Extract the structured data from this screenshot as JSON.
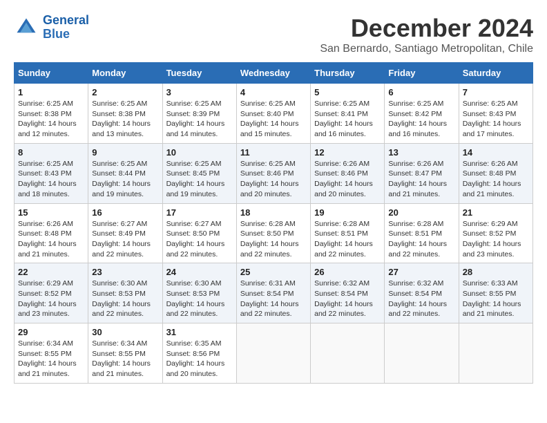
{
  "logo": {
    "line1": "General",
    "line2": "Blue"
  },
  "title": "December 2024",
  "location": "San Bernardo, Santiago Metropolitan, Chile",
  "days_header": [
    "Sunday",
    "Monday",
    "Tuesday",
    "Wednesday",
    "Thursday",
    "Friday",
    "Saturday"
  ],
  "weeks": [
    [
      {
        "day": "1",
        "sunrise": "Sunrise: 6:25 AM",
        "sunset": "Sunset: 8:38 PM",
        "daylight": "Daylight: 14 hours and 12 minutes."
      },
      {
        "day": "2",
        "sunrise": "Sunrise: 6:25 AM",
        "sunset": "Sunset: 8:38 PM",
        "daylight": "Daylight: 14 hours and 13 minutes."
      },
      {
        "day": "3",
        "sunrise": "Sunrise: 6:25 AM",
        "sunset": "Sunset: 8:39 PM",
        "daylight": "Daylight: 14 hours and 14 minutes."
      },
      {
        "day": "4",
        "sunrise": "Sunrise: 6:25 AM",
        "sunset": "Sunset: 8:40 PM",
        "daylight": "Daylight: 14 hours and 15 minutes."
      },
      {
        "day": "5",
        "sunrise": "Sunrise: 6:25 AM",
        "sunset": "Sunset: 8:41 PM",
        "daylight": "Daylight: 14 hours and 16 minutes."
      },
      {
        "day": "6",
        "sunrise": "Sunrise: 6:25 AM",
        "sunset": "Sunset: 8:42 PM",
        "daylight": "Daylight: 14 hours and 16 minutes."
      },
      {
        "day": "7",
        "sunrise": "Sunrise: 6:25 AM",
        "sunset": "Sunset: 8:43 PM",
        "daylight": "Daylight: 14 hours and 17 minutes."
      }
    ],
    [
      {
        "day": "8",
        "sunrise": "Sunrise: 6:25 AM",
        "sunset": "Sunset: 8:43 PM",
        "daylight": "Daylight: 14 hours and 18 minutes."
      },
      {
        "day": "9",
        "sunrise": "Sunrise: 6:25 AM",
        "sunset": "Sunset: 8:44 PM",
        "daylight": "Daylight: 14 hours and 19 minutes."
      },
      {
        "day": "10",
        "sunrise": "Sunrise: 6:25 AM",
        "sunset": "Sunset: 8:45 PM",
        "daylight": "Daylight: 14 hours and 19 minutes."
      },
      {
        "day": "11",
        "sunrise": "Sunrise: 6:25 AM",
        "sunset": "Sunset: 8:46 PM",
        "daylight": "Daylight: 14 hours and 20 minutes."
      },
      {
        "day": "12",
        "sunrise": "Sunrise: 6:26 AM",
        "sunset": "Sunset: 8:46 PM",
        "daylight": "Daylight: 14 hours and 20 minutes."
      },
      {
        "day": "13",
        "sunrise": "Sunrise: 6:26 AM",
        "sunset": "Sunset: 8:47 PM",
        "daylight": "Daylight: 14 hours and 21 minutes."
      },
      {
        "day": "14",
        "sunrise": "Sunrise: 6:26 AM",
        "sunset": "Sunset: 8:48 PM",
        "daylight": "Daylight: 14 hours and 21 minutes."
      }
    ],
    [
      {
        "day": "15",
        "sunrise": "Sunrise: 6:26 AM",
        "sunset": "Sunset: 8:48 PM",
        "daylight": "Daylight: 14 hours and 21 minutes."
      },
      {
        "day": "16",
        "sunrise": "Sunrise: 6:27 AM",
        "sunset": "Sunset: 8:49 PM",
        "daylight": "Daylight: 14 hours and 22 minutes."
      },
      {
        "day": "17",
        "sunrise": "Sunrise: 6:27 AM",
        "sunset": "Sunset: 8:50 PM",
        "daylight": "Daylight: 14 hours and 22 minutes."
      },
      {
        "day": "18",
        "sunrise": "Sunrise: 6:28 AM",
        "sunset": "Sunset: 8:50 PM",
        "daylight": "Daylight: 14 hours and 22 minutes."
      },
      {
        "day": "19",
        "sunrise": "Sunrise: 6:28 AM",
        "sunset": "Sunset: 8:51 PM",
        "daylight": "Daylight: 14 hours and 22 minutes."
      },
      {
        "day": "20",
        "sunrise": "Sunrise: 6:28 AM",
        "sunset": "Sunset: 8:51 PM",
        "daylight": "Daylight: 14 hours and 22 minutes."
      },
      {
        "day": "21",
        "sunrise": "Sunrise: 6:29 AM",
        "sunset": "Sunset: 8:52 PM",
        "daylight": "Daylight: 14 hours and 23 minutes."
      }
    ],
    [
      {
        "day": "22",
        "sunrise": "Sunrise: 6:29 AM",
        "sunset": "Sunset: 8:52 PM",
        "daylight": "Daylight: 14 hours and 23 minutes."
      },
      {
        "day": "23",
        "sunrise": "Sunrise: 6:30 AM",
        "sunset": "Sunset: 8:53 PM",
        "daylight": "Daylight: 14 hours and 22 minutes."
      },
      {
        "day": "24",
        "sunrise": "Sunrise: 6:30 AM",
        "sunset": "Sunset: 8:53 PM",
        "daylight": "Daylight: 14 hours and 22 minutes."
      },
      {
        "day": "25",
        "sunrise": "Sunrise: 6:31 AM",
        "sunset": "Sunset: 8:54 PM",
        "daylight": "Daylight: 14 hours and 22 minutes."
      },
      {
        "day": "26",
        "sunrise": "Sunrise: 6:32 AM",
        "sunset": "Sunset: 8:54 PM",
        "daylight": "Daylight: 14 hours and 22 minutes."
      },
      {
        "day": "27",
        "sunrise": "Sunrise: 6:32 AM",
        "sunset": "Sunset: 8:54 PM",
        "daylight": "Daylight: 14 hours and 22 minutes."
      },
      {
        "day": "28",
        "sunrise": "Sunrise: 6:33 AM",
        "sunset": "Sunset: 8:55 PM",
        "daylight": "Daylight: 14 hours and 21 minutes."
      }
    ],
    [
      {
        "day": "29",
        "sunrise": "Sunrise: 6:34 AM",
        "sunset": "Sunset: 8:55 PM",
        "daylight": "Daylight: 14 hours and 21 minutes."
      },
      {
        "day": "30",
        "sunrise": "Sunrise: 6:34 AM",
        "sunset": "Sunset: 8:55 PM",
        "daylight": "Daylight: 14 hours and 21 minutes."
      },
      {
        "day": "31",
        "sunrise": "Sunrise: 6:35 AM",
        "sunset": "Sunset: 8:56 PM",
        "daylight": "Daylight: 14 hours and 20 minutes."
      },
      null,
      null,
      null,
      null
    ]
  ]
}
